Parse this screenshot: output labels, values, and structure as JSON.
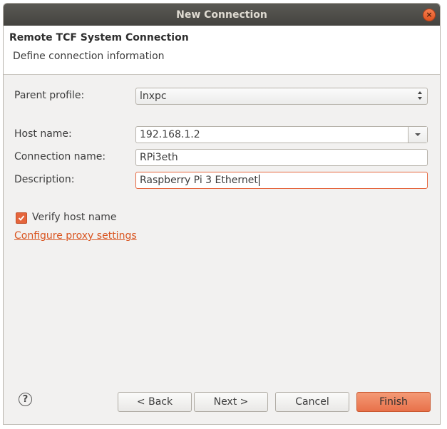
{
  "window": {
    "title": "New Connection",
    "close_glyph": "×"
  },
  "header": {
    "title": "Remote TCF System Connection",
    "subtitle": "Define connection information"
  },
  "form": {
    "parent_profile": {
      "label": "Parent profile:",
      "value": "lnxpc"
    },
    "host_name": {
      "label": "Host name:",
      "value": "192.168.1.2"
    },
    "connection_name": {
      "label": "Connection name:",
      "value": "RPi3eth"
    },
    "description": {
      "label": "Description:",
      "value": "Raspberry Pi 3 Ethernet"
    },
    "verify_host": {
      "label": "Verify host name",
      "checked": true
    },
    "proxy_link": "Configure proxy settings"
  },
  "footer": {
    "help_glyph": "?",
    "back_label": "< Back",
    "next_label": "Next >",
    "cancel_label": "Cancel",
    "finish_label": "Finish"
  },
  "colors": {
    "accent": "#e5653c",
    "link": "#d9531e",
    "titlebar": "#4a4945"
  }
}
